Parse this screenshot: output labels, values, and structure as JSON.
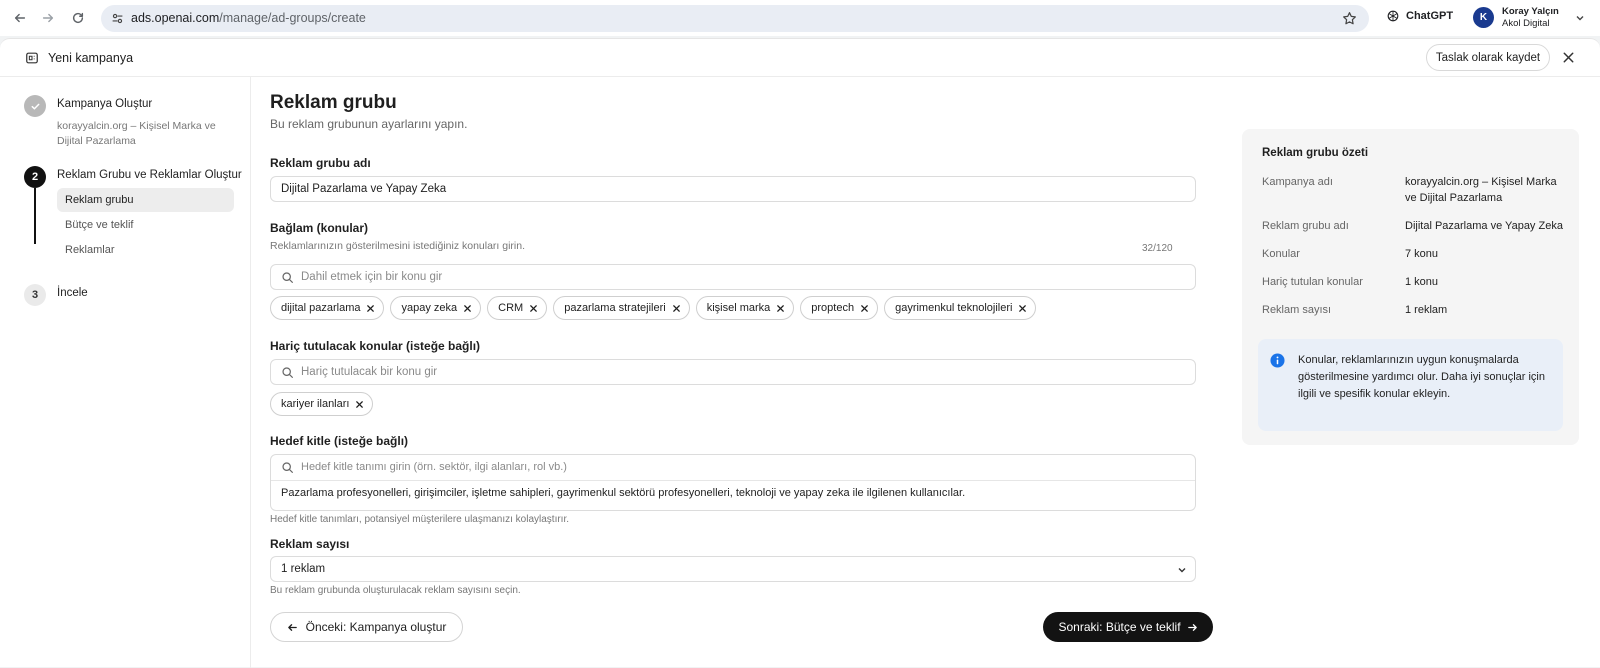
{
  "browser": {
    "url_host": "ads.openai.com",
    "url_path": "/manage/ad-groups/create",
    "chatgpt_label": "ChatGPT",
    "account_initial": "K",
    "account_name": "Koray Yalçın",
    "account_org": "Akol Digital"
  },
  "topbar": {
    "title": "Yeni kampanya",
    "draft_button": "Taslak olarak kaydet"
  },
  "stepper": {
    "steps": [
      {
        "number": "",
        "title": "Kampanya Oluştur",
        "subtitle": "korayyalcin.org – Kişisel Marka ve Dijital Pazarlama",
        "state": "done"
      },
      {
        "number": "2",
        "title": "Reklam Grubu ve Reklamlar Oluştur",
        "state": "active",
        "items": [
          "Reklam grubu",
          "Bütçe ve teklif",
          "Reklamlar"
        ]
      },
      {
        "number": "3",
        "title": "İncele",
        "state": "todo"
      }
    ]
  },
  "form": {
    "heading": "Reklam grubu",
    "subheading": "Bu reklam grubunun ayarlarını yapın.",
    "name_label": "Reklam grubu adı",
    "name_value": "Dijital Pazarlama ve Yapay Zeka",
    "name_counter": "32/120",
    "context_label": "Bağlam (konular)",
    "context_hint": "Reklamlarınızın gösterilmesini istediğiniz konuları girin.",
    "context_placeholder": "Dahil etmek için bir konu gir",
    "topics": [
      "dijital pazarlama",
      "yapay zeka",
      "CRM",
      "pazarlama stratejileri",
      "kişisel marka",
      "proptech",
      "gayrimenkul teknolojileri"
    ],
    "excluded_label": "Hariç tutulacak konular (isteğe bağlı)",
    "excluded_placeholder": "Hariç tutulacak bir konu gir",
    "excluded_topics": [
      "kariyer ilanları"
    ],
    "audience_label": "Hedef kitle (isteğe bağlı)",
    "audience_placeholder": "Hedef kitle tanımı girin (örn. sektör, ilgi alanları, rol vb.)",
    "audience_value": "Pazarlama profesyonelleri, girişimciler, işletme sahipleri, gayrimenkul sektörü profesyonelleri, teknoloji ve yapay zeka ile ilgilenen kullanıcılar.",
    "audience_hint": "Hedef kitle tanımları, potansiyel müşterilere ulaşmanızı kolaylaştırır.",
    "ads_count_label": "Reklam sayısı",
    "ads_count_value": "1 reklam",
    "ads_count_hint": "Bu reklam grubunda oluşturulacak reklam sayısını seçin.",
    "prev_button": "Önceki: Kampanya oluştur",
    "next_button": "Sonraki: Bütçe ve teklif"
  },
  "summary": {
    "title": "Reklam grubu özeti",
    "rows": [
      {
        "key": "Kampanya adı",
        "value": "korayyalcin.org – Kişisel Marka ve Dijital Pazarlama"
      },
      {
        "key": "Reklam grubu adı",
        "value": "Dijital Pazarlama ve Yapay Zeka"
      },
      {
        "key": "Konular",
        "value": "7 konu"
      },
      {
        "key": "Hariç tutulan konular",
        "value": "1 konu"
      },
      {
        "key": "Reklam sayısı",
        "value": "1 reklam"
      }
    ],
    "info_text": "Konular, reklamlarınızın uygun konuşmalarda gösterilmesine yardımcı olur. Daha iyi sonuçlar için ilgili ve spesifik konular ekleyin."
  },
  "colors": {
    "primary_button": "#131313",
    "info_icon": "#1a73e8",
    "avatar": "#1a3a8f"
  }
}
